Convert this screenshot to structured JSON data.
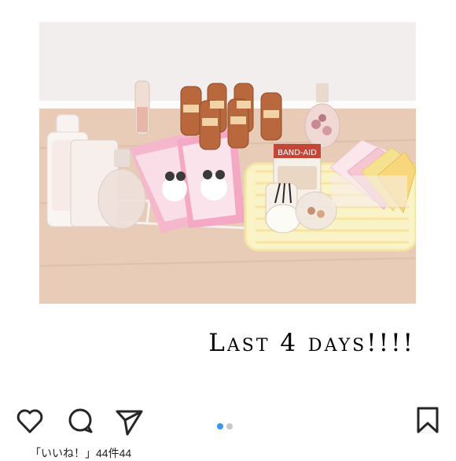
{
  "post": {
    "caption": "Last 4 days!!!!",
    "product_label": "BAND-AID",
    "bottom_text": "「いいね！」44件44"
  },
  "carousel": {
    "count": 2,
    "active_index": 0
  },
  "actions": {
    "like_icon": "heart-icon",
    "comment_icon": "comment-icon",
    "share_icon": "paper-plane-icon",
    "save_icon": "bookmark-icon"
  },
  "colors": {
    "active_dot": "#3897f0",
    "inactive_dot": "#c7c7c7",
    "icon_stroke": "#262626"
  }
}
